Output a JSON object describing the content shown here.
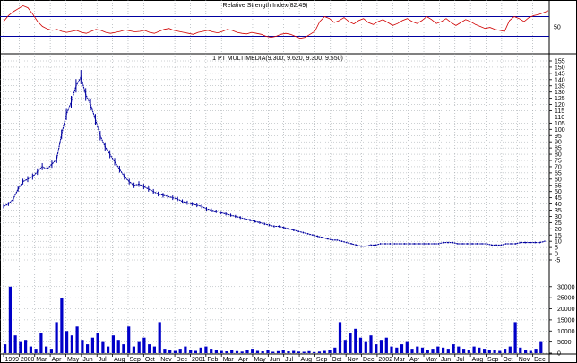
{
  "colors": {
    "grid": "#9aa0a6",
    "price": "#0000a0",
    "volume": "#0000c8",
    "rsi": "#d00000",
    "rsi_band": "#0000a0",
    "axis": "#000000"
  },
  "chart_data": [
    {
      "type": "line",
      "title": "Relative Strength Index(82.49)",
      "ylabel": "",
      "ticks": [
        "50"
      ],
      "ylim": [
        0,
        100
      ],
      "bands": [
        70,
        30
      ],
      "series": [
        {
          "values": [
            60,
            72,
            80,
            86,
            92,
            88,
            75,
            60,
            50,
            45,
            42,
            44,
            40,
            38,
            40,
            42,
            38,
            36,
            40,
            44,
            42,
            38,
            36,
            38,
            40,
            43,
            41,
            39,
            40,
            42,
            38,
            36,
            40,
            44,
            46,
            42,
            40,
            38,
            36,
            34,
            38,
            40,
            42,
            39,
            37,
            40,
            44,
            42,
            38,
            36,
            35,
            38,
            36,
            34,
            30,
            28,
            30,
            34,
            36,
            34,
            30,
            26,
            28,
            34,
            40,
            60,
            70,
            66,
            58,
            62,
            68,
            60,
            55,
            62,
            66,
            58,
            54,
            60,
            64,
            58,
            52,
            56,
            62,
            66,
            60,
            56,
            62,
            70,
            64,
            56,
            60,
            66,
            58,
            52,
            58,
            64,
            60,
            54,
            50,
            46,
            48,
            44,
            42,
            40,
            62,
            70,
            66,
            60,
            68,
            72,
            74,
            78,
            82
          ]
        }
      ]
    },
    {
      "type": "line",
      "title": "1 PT MULTIMEDIA(9.300, 9.620, 9.300, 9.550)",
      "xlabel": "",
      "ylabel": "",
      "ylim": [
        -5,
        155
      ],
      "y_ticks": [
        "155",
        "150",
        "145",
        "140",
        "135",
        "130",
        "125",
        "120",
        "115",
        "110",
        "105",
        "100",
        "95",
        "90",
        "85",
        "80",
        "75",
        "70",
        "65",
        "60",
        "55",
        "50",
        "45",
        "40",
        "35",
        "30",
        "25",
        "20",
        "15",
        "10",
        "5",
        "0",
        "-5"
      ],
      "series": [
        {
          "values": [
            38,
            40,
            44,
            52,
            58,
            60,
            62,
            66,
            70,
            68,
            72,
            76,
            96,
            112,
            122,
            135,
            142,
            128,
            120,
            108,
            95,
            86,
            80,
            74,
            68,
            62,
            58,
            55,
            56,
            54,
            52,
            50,
            48,
            47,
            46,
            45,
            44,
            42,
            41,
            40,
            39,
            38,
            36,
            35,
            34,
            33,
            32,
            31,
            30,
            29,
            28,
            27,
            26,
            25,
            24,
            23,
            22,
            22,
            21,
            20,
            19,
            18,
            17,
            16,
            15,
            14,
            13,
            12,
            11,
            11,
            10,
            9,
            8,
            7,
            6,
            6,
            7,
            7,
            8,
            8,
            8,
            8,
            8,
            8,
            8,
            8,
            8,
            8,
            8,
            8,
            8,
            9,
            9,
            9,
            8,
            8,
            8,
            8,
            8,
            8,
            8,
            7,
            7,
            7,
            8,
            8,
            8,
            9,
            9,
            9,
            9,
            9,
            10
          ]
        }
      ]
    },
    {
      "type": "bar",
      "title": "",
      "ylim": [
        0,
        38000
      ],
      "y_ticks": [
        "30000",
        "25000",
        "20000",
        "15000",
        "10000",
        "5000",
        "0"
      ],
      "x_ticks": [
        "1999",
        "2000",
        "Mar",
        "Apr",
        "May",
        "Jun",
        "Jul",
        "Aug",
        "Sep",
        "Oct",
        "Nov",
        "Dec",
        "2001",
        "Feb",
        "Mar",
        "Apr",
        "May",
        "Jun",
        "Jul",
        "Aug",
        "Sep",
        "Oct",
        "Nov",
        "Dec",
        "2002",
        "Mar",
        "Apr",
        "May",
        "Jun",
        "Jul",
        "Aug",
        "Sep",
        "Oct",
        "Nov",
        "Dec"
      ],
      "series": [
        {
          "values": [
            4000,
            30000,
            8000,
            5000,
            6000,
            3000,
            2000,
            9000,
            3000,
            2000,
            14000,
            25000,
            10000,
            8000,
            12000,
            6000,
            4000,
            7000,
            9000,
            5000,
            3000,
            8000,
            6000,
            4000,
            12000,
            3000,
            5000,
            7000,
            4000,
            3000,
            14000,
            2000,
            1500,
            1000,
            2000,
            3000,
            1500,
            1000,
            2500,
            3000,
            2000,
            1500,
            1000,
            800,
            1200,
            900,
            700,
            1500,
            2000,
            1000,
            800,
            1200,
            600,
            900,
            1400,
            800,
            1000,
            700,
            600,
            900,
            500,
            700,
            1000,
            1200,
            2500,
            14000,
            6000,
            9000,
            11000,
            7000,
            5000,
            8000,
            4000,
            6000,
            7000,
            3000,
            2500,
            4000,
            5000,
            2000,
            3000,
            2500,
            1500,
            2000,
            3000,
            2500,
            2000,
            4000,
            3000,
            2000,
            1500,
            3000,
            2500,
            2000,
            1500,
            1200,
            1000,
            2000,
            3000,
            14000,
            2500,
            1500,
            1000,
            2000,
            5000
          ]
        }
      ]
    }
  ]
}
